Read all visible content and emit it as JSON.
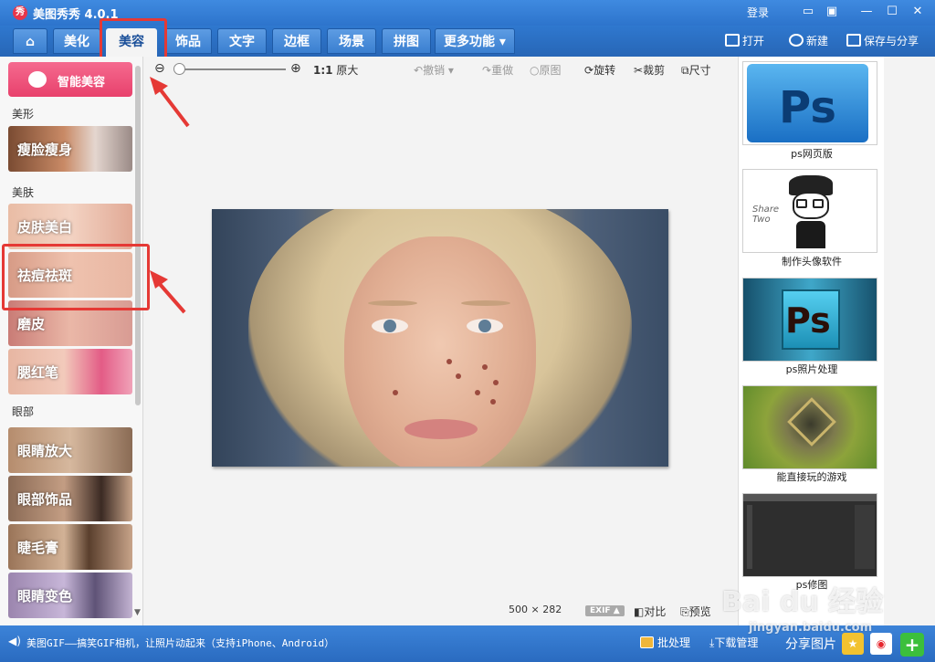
{
  "app": {
    "title": "美图秀秀 4.0.1",
    "logo_text": "秀",
    "login": "登录"
  },
  "tabs": [
    {
      "label": "美化"
    },
    {
      "label": "美容"
    },
    {
      "label": "饰品"
    },
    {
      "label": "文字"
    },
    {
      "label": "边框"
    },
    {
      "label": "场景"
    },
    {
      "label": "拼图"
    },
    {
      "label": "更多功能 ▾"
    }
  ],
  "active_tab": "美容",
  "header_actions": {
    "open": "打开",
    "new": "新建",
    "save": "保存与分享"
  },
  "left_panel": {
    "smart_button": "智能美容",
    "sections": [
      {
        "label": "美形",
        "items": [
          "瘦脸瘦身"
        ]
      },
      {
        "label": "美肤",
        "items": [
          "皮肤美白",
          "祛痘祛斑",
          "磨皮",
          "腮红笔"
        ]
      },
      {
        "label": "眼部",
        "items": [
          "眼睛放大",
          "眼部饰品",
          "睫毛膏",
          "眼睛变色"
        ]
      }
    ]
  },
  "canvas_toolbar": {
    "original_size_ratio": "1:1",
    "original_size_label": "原大",
    "undo": "撤销",
    "redo": "重做",
    "original_image": "原图",
    "rotate": "旋转",
    "crop": "裁剪",
    "size": "尺寸"
  },
  "image_info": {
    "dimensions": "500 × 282",
    "exif": "EXIF ▲",
    "compare": "对比",
    "preview": "预览"
  },
  "recommendations": [
    {
      "caption": "ps网页版",
      "logo": "Ps"
    },
    {
      "caption": "制作头像软件",
      "logo": "Share Two"
    },
    {
      "caption": "ps照片处理",
      "logo": "Ps"
    },
    {
      "caption": "能直接玩的游戏",
      "logo": ""
    },
    {
      "caption": "ps修图",
      "logo": ""
    }
  ],
  "status_bar": {
    "message": "美图GIF——搞笑GIF相机，让照片动起来（支持iPhone、Android）",
    "batch": "批处理",
    "download_manager": "下载管理",
    "share": "分享图片"
  },
  "watermark": {
    "brand": "Bai du 经验",
    "url": "jingyan.baidu.com"
  },
  "colors": {
    "title_bar": "#3f8ae0",
    "smart_button": "#e8416c",
    "highlight": "#e53935",
    "status_bar": "#2a6bc0"
  }
}
